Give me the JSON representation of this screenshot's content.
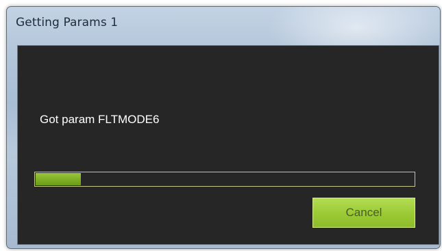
{
  "window": {
    "title": "Getting Params 1"
  },
  "dialog": {
    "message": "Got param FLTMODE6",
    "progress": 0.12,
    "cancel_label": "Cancel"
  },
  "colors": {
    "client_background": "#262626",
    "progress_fill": "#7eae24",
    "button_green": "#9ccb37"
  }
}
